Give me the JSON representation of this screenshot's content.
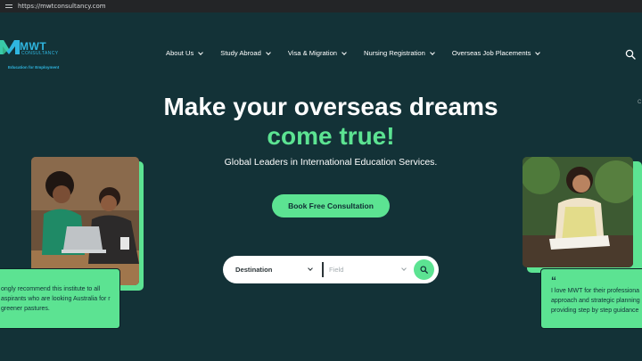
{
  "browser": {
    "url": "https://mwtconsultancy.com"
  },
  "logo": {
    "brand": "MWT",
    "sub": "CONSULTANCY",
    "tagline": "Education for Employment"
  },
  "nav": {
    "items": [
      {
        "label": "About Us"
      },
      {
        "label": "Study Abroad"
      },
      {
        "label": "Visa & Migration"
      },
      {
        "label": "Nursing Registration"
      },
      {
        "label": "Overseas Job Placements"
      }
    ]
  },
  "hero": {
    "title_line1": "Make your overseas dreams",
    "title_line2": "come true!",
    "subtitle": "Global Leaders in International Education Services.",
    "cta_label": "Book Free Consultation",
    "edge_char": "C"
  },
  "search": {
    "destination_label": "Destination",
    "field_label": "Field"
  },
  "testimonials": {
    "left": "ongly recommend this institute to all aspirants who are looking Australia for r greener pastures.",
    "right_quote_mark": "“",
    "right": "I love MWT for their professiona approach and strategic planning providing step by step guidance"
  },
  "colors": {
    "background": "#133237",
    "accent": "#5ce392",
    "brand": "#2fb6e0"
  }
}
